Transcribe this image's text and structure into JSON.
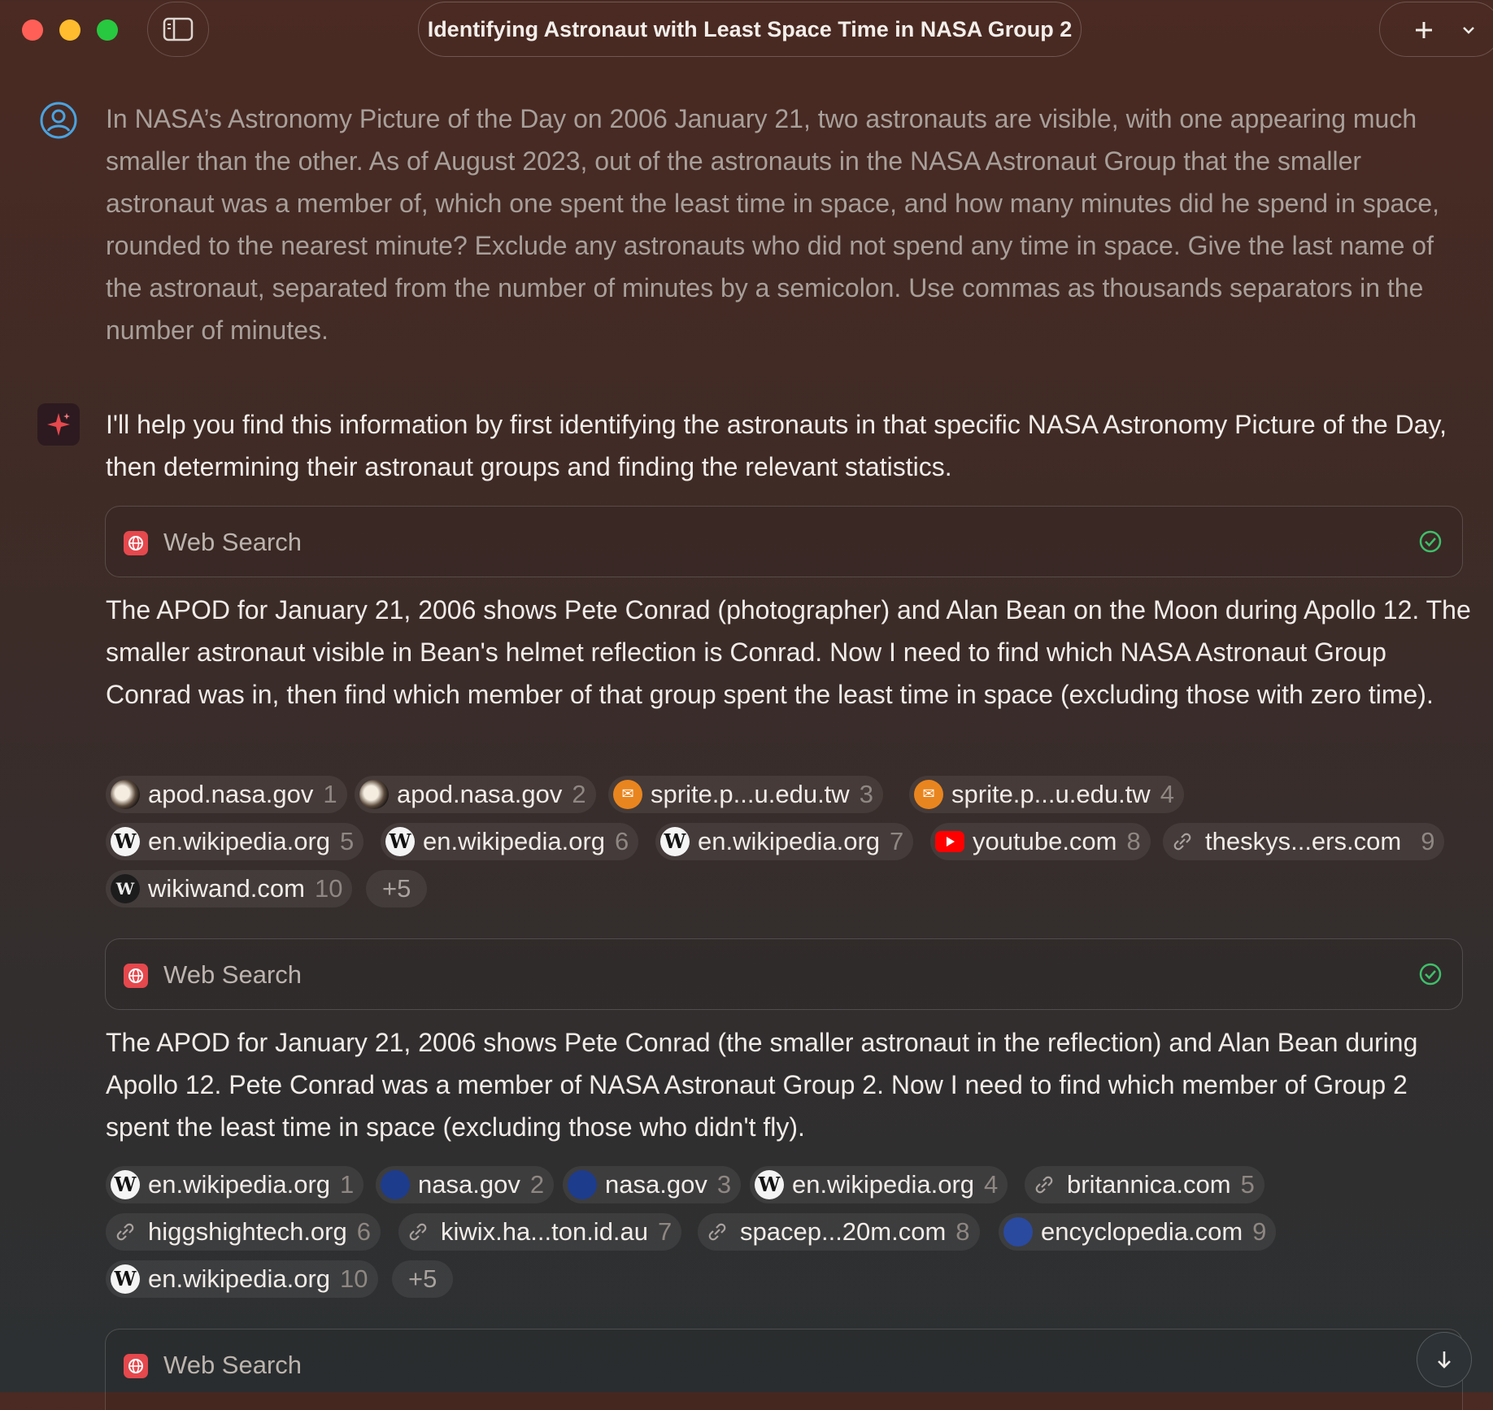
{
  "window": {
    "title": "Identifying Astronaut with Least Space Time in NASA Group 2",
    "new_chat_icon": "plus-icon",
    "menu_icon": "chevron-down-icon",
    "sidebar_icon": "sidebar-toggle-icon"
  },
  "user_message": "In NASA’s Astronomy Picture of the Day on 2006 January 21, two astronauts are visible, with one appearing much smaller than the other. As of August 2023, out of the astronauts in the NASA Astronaut Group that the smaller astronaut was a member of, which one spent the least time in space, and how many minutes did he spend in space, rounded to the nearest minute? Exclude any astronauts who did not spend any time in space. Give the last name of the astronaut, separated from the number of minutes by a semicolon. Use commas as thousands separators in the number of minutes.",
  "assistant": {
    "intro": "I'll help you find this information by first identifying the astronauts in that specific NASA Astronomy Picture of the Day, then determining their astronaut groups and finding the relevant statistics.",
    "tool_label": "Web Search",
    "step1": {
      "text": "The APOD for January 21, 2006 shows Pete Conrad (photographer) and Alan Bean on the Moon during Apollo 12. The smaller astronaut visible in Bean's helmet reflection is Conrad. Now I need to find which NASA Astronaut Group Conrad was in, then find which member of that group spent the least time in space (excluding those with zero time).",
      "sources": [
        {
          "domain": "apod.nasa.gov",
          "num": "1",
          "icon": "apod"
        },
        {
          "domain": "apod.nasa.gov",
          "num": "2",
          "icon": "apod"
        },
        {
          "domain": "sprite.p...u.edu.tw",
          "num": "3",
          "icon": "sprite"
        },
        {
          "domain": "sprite.p...u.edu.tw",
          "num": "4",
          "icon": "sprite"
        },
        {
          "domain": "en.wikipedia.org",
          "num": "5",
          "icon": "wiki"
        },
        {
          "domain": "en.wikipedia.org",
          "num": "6",
          "icon": "wiki"
        },
        {
          "domain": "en.wikipedia.org",
          "num": "7",
          "icon": "wiki"
        },
        {
          "domain": "youtube.com",
          "num": "8",
          "icon": "youtube"
        },
        {
          "domain": "theskys...ers.com",
          "num": "9",
          "icon": "link"
        },
        {
          "domain": "wikiwand.com",
          "num": "10",
          "icon": "wikiwand"
        }
      ],
      "more": "+5"
    },
    "step2": {
      "text": "The APOD for January 21, 2006 shows Pete Conrad (the smaller astronaut in the reflection) and Alan Bean during Apollo 12. Pete Conrad was a member of NASA Astronaut Group 2. Now I need to find which member of Group 2 spent the least time in space (excluding those who didn't fly).",
      "sources": [
        {
          "domain": "en.wikipedia.org",
          "num": "1",
          "icon": "wiki"
        },
        {
          "domain": "nasa.gov",
          "num": "2",
          "icon": "nasa"
        },
        {
          "domain": "nasa.gov",
          "num": "3",
          "icon": "nasa"
        },
        {
          "domain": "en.wikipedia.org",
          "num": "4",
          "icon": "wiki"
        },
        {
          "domain": "britannica.com",
          "num": "5",
          "icon": "link"
        },
        {
          "domain": "higgshightech.org",
          "num": "6",
          "icon": "link"
        },
        {
          "domain": "kiwix.ha...ton.id.au",
          "num": "7",
          "icon": "link"
        },
        {
          "domain": "spacep...20m.com",
          "num": "8",
          "icon": "link"
        },
        {
          "domain": "encyclopedia.com",
          "num": "9",
          "icon": "encyclopedia"
        },
        {
          "domain": "en.wikipedia.org",
          "num": "10",
          "icon": "wiki"
        }
      ],
      "more": "+5"
    }
  },
  "colors": {
    "accent_red": "#e5484d",
    "success_green": "#3fbf6a",
    "user_avatar_blue": "#4aa3e0"
  }
}
